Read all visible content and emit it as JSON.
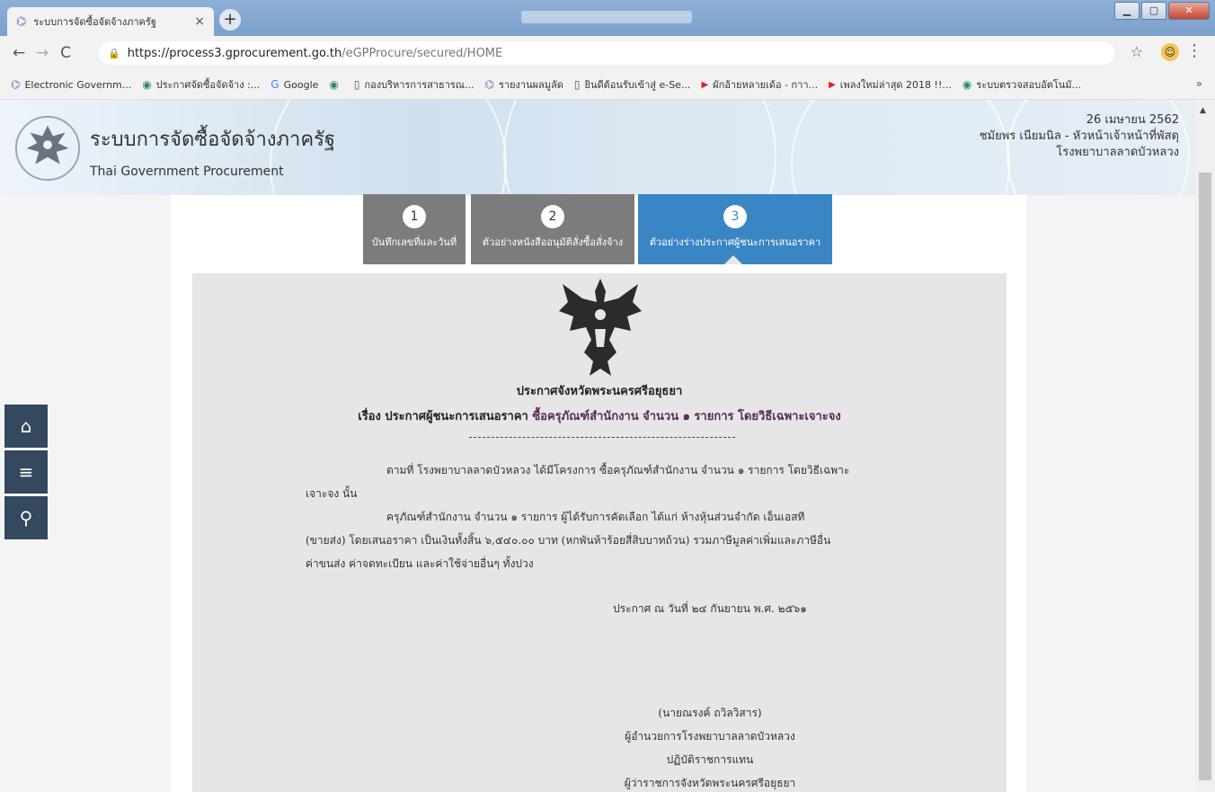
{
  "browser": {
    "tab_title": "ระบบการจัดซื้อจัดจ้างภาครัฐ",
    "tab_close": "×",
    "new_tab": "+",
    "url_host": "https://process3.gprocurement.go.th",
    "url_path": "/eGPProcure/secured/HOME",
    "bookmarks": [
      {
        "icon": "e-gov-icon",
        "label": "Electronic Governm..."
      },
      {
        "icon": "seal-icon",
        "label": "ประกาศจัดซื้อจัดจ้าง :..."
      },
      {
        "icon": "google-icon",
        "label": "Google"
      },
      {
        "icon": "seal-icon",
        "label": ""
      },
      {
        "icon": "page-icon",
        "label": "กองบริหารการสาธารณ..."
      },
      {
        "icon": "e-gov-icon",
        "label": "รายงานผลมูลัด"
      },
      {
        "icon": "page-icon",
        "label": "ยินดีต้อนรับเข้าสู่ e-Se..."
      },
      {
        "icon": "youtube-icon",
        "label": "ผักอ้ายหลายเด้อ - กาา..."
      },
      {
        "icon": "youtube-icon",
        "label": "เพลงใหม่ล่าสุด 2018 !!..."
      },
      {
        "icon": "seal-icon",
        "label": "ระบบตรวจสอบอัตโนมั..."
      }
    ],
    "bookmarks_more": "»"
  },
  "header": {
    "title_th": "ระบบการจัดซื้อจัดจ้างภาครัฐ",
    "title_en": "Thai Government Procurement",
    "date": "26 เมษายน 2562",
    "user": "ชมัยพร เนียมนิล - หัวหน้าเจ้าหน้าที่พัสดุ",
    "org": "โรงพยาบาลลาดบัวหลวง"
  },
  "steps": [
    {
      "num": "1",
      "label": "บันทึกเลขที่และวันที่"
    },
    {
      "num": "2",
      "label": "ตัวอย่างหนังสืออนุมัติสั่งซื้อสั่งจ้าง"
    },
    {
      "num": "3",
      "label": "ตัวอย่างร่างประกาศผู้ชนะการเสนอราคา"
    }
  ],
  "doc": {
    "heading": "ประกาศจังหวัดพระนครศรีอยุธยา",
    "subject_prefix": "เรื่อง ประกาศผู้ชนะการเสนอราคา",
    "subject_rest": "ซื้อครุภัณฑ์สำนักงาน จำนวน ๑ รายการ โดยวิธีเฉพาะเจาะจง",
    "p1_line1": "ตามที่ โรงพยาบาลลาดบัวหลวง ได้มีโครงการ ซื้อครุภัณฑ์สำนักงาน จำนวน ๑ รายการ โดยวิธีเฉพาะ",
    "p1_line2": "เจาะจง  นั้น",
    "p2_line1": "ครุภัณฑ์สำนักงาน จำนวน ๑ รายการ ผู้ได้รับการคัดเลือก ได้แก่ ห้างหุ้นส่วนจำกัด เอ็นเอสที",
    "p2_line2": "(ขายส่ง) โดยเสนอราคา เป็นเงินทั้งสิ้น ๖,๕๔๐.๐๐ บาท (หกพันห้าร้อยสี่สิบบาทถ้วน) รวมภาษีมูลค่าเพิ่มและภาษีอื่น",
    "p2_line3": "ค่าขนส่ง ค่าจดทะเบียน และค่าใช้จ่ายอื่นๆ ทั้งปวง",
    "announce_date": "ประกาศ ณ วันที่  ๒๔ กันยายน พ.ศ. ๒๕๖๑",
    "signer_name": "(นายณรงค์ ถวิลวิสาร)",
    "signer_title1": "ผู้อำนวยการโรงพยาบาลลาดบัวหลวง",
    "signer_title2": "ปฏิบัติราชการแทน",
    "signer_title3": "ผู้ว่าราชการจังหวัดพระนครศรีอยุธยา"
  },
  "colors": {
    "step_active": "#3a85c4",
    "step_inactive": "#7c7c7c",
    "sidenav": "#34485f"
  }
}
